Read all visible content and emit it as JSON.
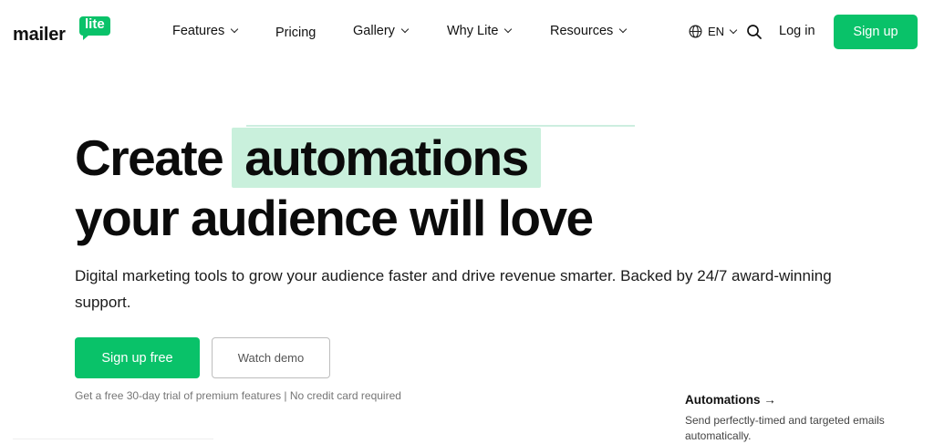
{
  "brand": {
    "logo_word": "mailer",
    "logo_badge": "lite",
    "accent_color": "#09c269",
    "highlight_color": "#c9f0dc"
  },
  "nav": {
    "items": [
      {
        "label": "Features",
        "has_dropdown": true
      },
      {
        "label": "Pricing",
        "has_dropdown": false
      },
      {
        "label": "Gallery",
        "has_dropdown": true
      },
      {
        "label": "Why Lite",
        "has_dropdown": true
      },
      {
        "label": "Resources",
        "has_dropdown": true
      }
    ],
    "language": "EN",
    "login_label": "Log in",
    "signup_label": "Sign up",
    "icons": [
      "globe-icon",
      "chevron-down-icon",
      "search-icon"
    ]
  },
  "hero": {
    "headline_start": "Create",
    "headline_highlight": "automations",
    "headline_end": "your audience will love",
    "subtext": "Digital marketing tools to grow your audience faster and drive revenue smarter. Backed by 24/7 award-winning support.",
    "primary_cta": "Sign up free",
    "secondary_cta": "Watch demo",
    "trial_note": "Get a free 30-day trial of premium features | No credit card required"
  },
  "feature_card": {
    "title": "Automations",
    "arrow": "→",
    "description": "Send perfectly-timed and targeted emails automatically."
  }
}
